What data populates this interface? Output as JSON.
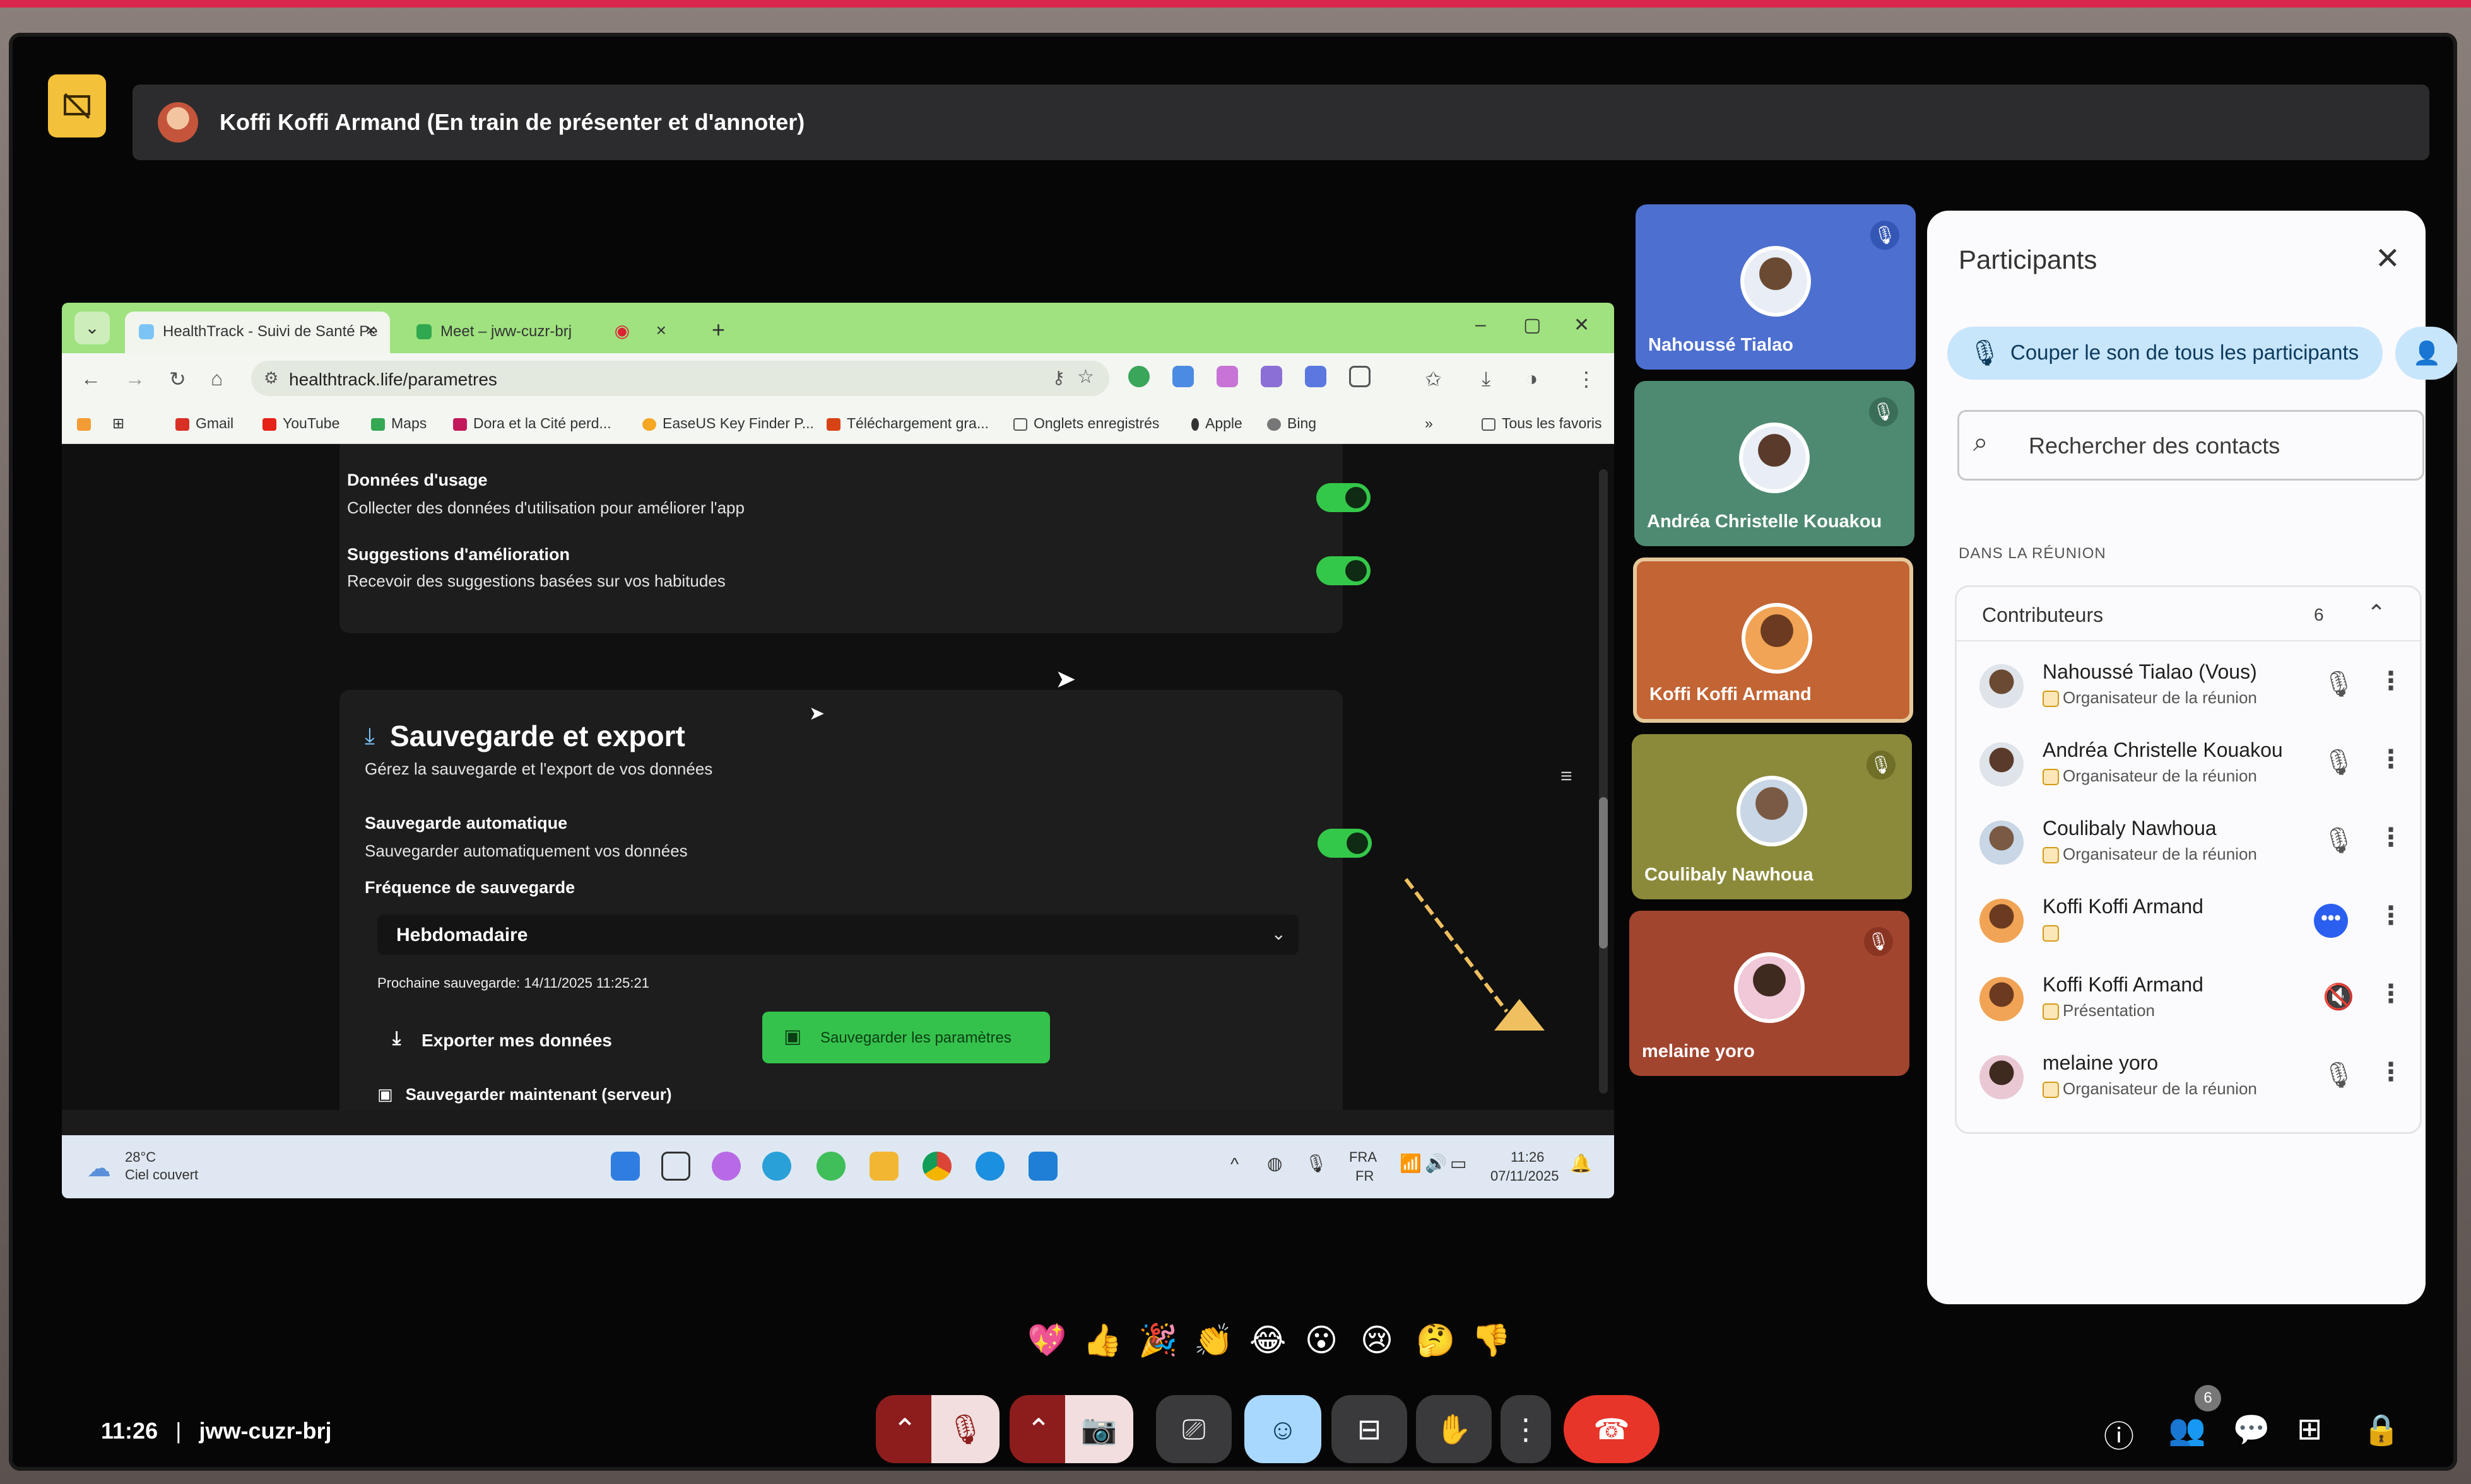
{
  "meet": {
    "presenter_label": "Koffi Koffi Armand (En train de présenter et d'annoter)",
    "time": "11:26",
    "meeting_code": "jww-cuzr-brj"
  },
  "browser": {
    "tabs": [
      {
        "label": "HealthTrack - Suivi de Santé Pe",
        "active": true
      },
      {
        "label": "Meet – jww-cuzr-brj",
        "active": false
      }
    ],
    "url": "healthtrack.life/parametres",
    "bookmarks": [
      "Gmail",
      "YouTube",
      "Maps",
      "Dora et la Cité perd...",
      "EaseUS Key Finder P...",
      "Téléchargement gra...",
      "Onglets enregistrés",
      "Apple",
      "Bing",
      "Tous les favoris"
    ]
  },
  "settings_page": {
    "usage_title": "Données d'usage",
    "usage_desc": "Collecter des données d'utilisation pour améliorer l'app",
    "usage_enabled": true,
    "suggest_title": "Suggestions d'amélioration",
    "suggest_desc": "Recevoir des suggestions basées sur vos habitudes",
    "suggest_enabled": true,
    "backup_title": "Sauvegarde et export",
    "backup_subtitle": "Gérez la sauvegarde et l'export de vos données",
    "auto_title": "Sauvegarde automatique",
    "auto_desc": "Sauvegarder automatiquement vos données",
    "auto_enabled": true,
    "freq_label": "Fréquence de sauvegarde",
    "freq_value": "Hebdomadaire",
    "next_backup": "Prochaine sauvegarde: 14/11/2025 11:25:21",
    "export_label": "Exporter mes données",
    "save_label": "Sauvegarder les paramètres",
    "save_now_label": "Sauvegarder maintenant (serveur)"
  },
  "taskbar": {
    "temp": "28°C",
    "weather": "Ciel couvert",
    "lang": "FRA",
    "lang2": "FR",
    "time": "11:26",
    "date": "07/11/2025"
  },
  "tiles": [
    {
      "name": "Nahoussé Tialao",
      "muted": true
    },
    {
      "name": "Andréa Christelle Kouakou",
      "muted": true
    },
    {
      "name": "Koffi Koffi Armand",
      "muted": false
    },
    {
      "name": "Coulibaly Nawhoua",
      "muted": true
    },
    {
      "name": "melaine yoro",
      "muted": true
    }
  ],
  "panel": {
    "title": "Participants",
    "mute_all": "Couper le son de tous les participants",
    "search_placeholder": "Rechercher des contacts",
    "section": "DANS LA RÉUNION",
    "group_name": "Contributeurs",
    "group_count": "6",
    "participants": [
      {
        "name": "Nahoussé Tialao (Vous)",
        "role": "Organisateur de la réunion"
      },
      {
        "name": "Andréa Christelle Kouakou",
        "role": "Organisateur de la réunion"
      },
      {
        "name": "Coulibaly Nawhoua",
        "role": "Organisateur de la réunion"
      },
      {
        "name": "Koffi Koffi Armand",
        "role": ""
      },
      {
        "name": "Koffi Koffi Armand",
        "role": "Présentation"
      },
      {
        "name": "melaine yoro",
        "role": "Organisateur de la réunion"
      }
    ]
  },
  "controls": {
    "participants_badge": "6"
  },
  "reactions": [
    "💖",
    "👍",
    "🎉",
    "👏",
    "😂",
    "😮",
    "😢",
    "🤔",
    "👎"
  ],
  "colors": {
    "accent_green": "#35c24c",
    "meet_blue": "#a9d8ff",
    "end_call_red": "#e7352a",
    "tab_green": "#9fe27f"
  }
}
